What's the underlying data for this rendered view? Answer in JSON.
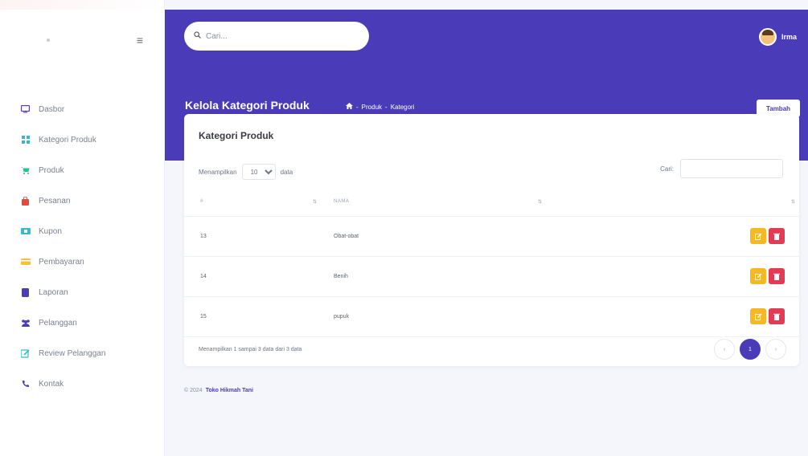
{
  "sidebar": {
    "items": [
      {
        "label": "Dasbor",
        "icon": "monitor-icon",
        "color": "#4a3bb8"
      },
      {
        "label": "Kategori Produk",
        "icon": "grid-icon",
        "color": "#36b9cc"
      },
      {
        "label": "Produk",
        "icon": "cart-icon",
        "color": "#1cc88a"
      },
      {
        "label": "Pesanan",
        "icon": "bag-icon",
        "color": "#e74a3b"
      },
      {
        "label": "Kupon",
        "icon": "ticket-icon",
        "color": "#36b9cc"
      },
      {
        "label": "Pembayaran",
        "icon": "card-icon",
        "color": "#f6c23e"
      },
      {
        "label": "Laporan",
        "icon": "book-icon",
        "color": "#4a3bb8"
      },
      {
        "label": "Pelanggan",
        "icon": "users-icon",
        "color": "#4a3bb8"
      },
      {
        "label": "Review Pelanggan",
        "icon": "edit-icon",
        "color": "#36b9cc"
      },
      {
        "label": "Kontak",
        "icon": "phone-icon",
        "color": "#4a3bb8"
      }
    ]
  },
  "header": {
    "search_placeholder": "Cari...",
    "user_name": "Irma",
    "page_title": "Kelola Kategori Produk",
    "breadcrumb": [
      "Produk",
      "Kategori"
    ],
    "add_button": "Tambah"
  },
  "card": {
    "title": "Kategori Produk",
    "length_prefix": "Menampilkan",
    "length_value": "10",
    "length_suffix": "data",
    "search_label": "Cari:",
    "columns": [
      "#",
      "NAMA"
    ],
    "rows": [
      {
        "id": "13",
        "name": "Obat-obat"
      },
      {
        "id": "14",
        "name": "Benih"
      },
      {
        "id": "15",
        "name": "pupuk"
      }
    ],
    "info": "Menampilkan 1 sampai 3 data dari 3 data",
    "pager": {
      "prev": "‹",
      "current": "1",
      "next": "›"
    }
  },
  "footer": {
    "copyright": "© 2024",
    "brand": "Toko Hikmah Tani"
  },
  "colors": {
    "primary": "#4a3bb8",
    "edit": "#f6b925",
    "delete": "#e33b54"
  }
}
